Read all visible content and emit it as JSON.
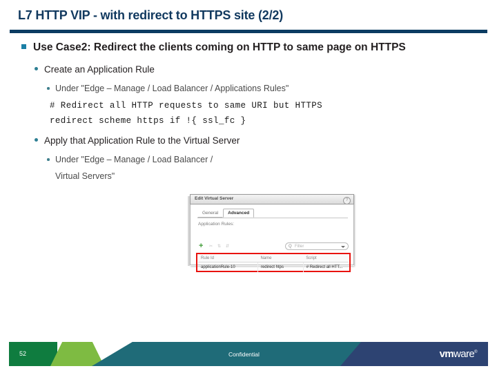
{
  "slide": {
    "title": "L7 HTTP VIP - with redirect to HTTPS site (2/2)",
    "title_color": "#11395f",
    "rule_color": "#0b3c62"
  },
  "bullets": {
    "level1": "Use Case2: Redirect the clients coming on HTTP to same page on HTTPS",
    "level2_a": "Create an Application Rule",
    "level3_a": "Under \"Edge – Manage /  Load Balancer / Applications Rules\"",
    "code_line_1": "# Redirect all HTTP requests to same URI but HTTPS",
    "code_line_2": "redirect scheme https if !{ ssl_fc }",
    "level2_b": "Apply that Application Rule to the Virtual Server",
    "level3_b_line1": "Under \"Edge – Manage /  Load Balancer /",
    "level3_b_line2": "Virtual Servers\"",
    "square_bullet_color": "#1b7fa5",
    "dot_bullet_color": "#2d7f93"
  },
  "screenshot": {
    "titlebar": "Edit Virtual Server",
    "help_glyph": "?",
    "tabs": [
      {
        "label": "General",
        "active": false
      },
      {
        "label": "Advanced",
        "active": true
      }
    ],
    "panel_label": "Application Rules:",
    "toolbar": {
      "add_glyph": "+",
      "ghost_1": "✂",
      "ghost_2": "⇅",
      "ghost_3": "⇵"
    },
    "filter": {
      "magnifier": "Q",
      "placeholder": "Filter"
    },
    "table": {
      "columns": [
        "Rule Id",
        "Name",
        "Script"
      ],
      "rows": [
        [
          "applicationRule-10",
          "redirect htps",
          "# Redirect all HTT..."
        ]
      ]
    },
    "highlight_color": "#e8120e"
  },
  "footer": {
    "page_number": "52",
    "classification": "Confidential",
    "logo_bold": "vm",
    "logo_rest": "ware",
    "logo_tm": "®",
    "colors": {
      "green": "#0f7c3f",
      "light_green": "#7ebb42",
      "teal": "#1f6b78",
      "navy": "#2d4372"
    }
  }
}
